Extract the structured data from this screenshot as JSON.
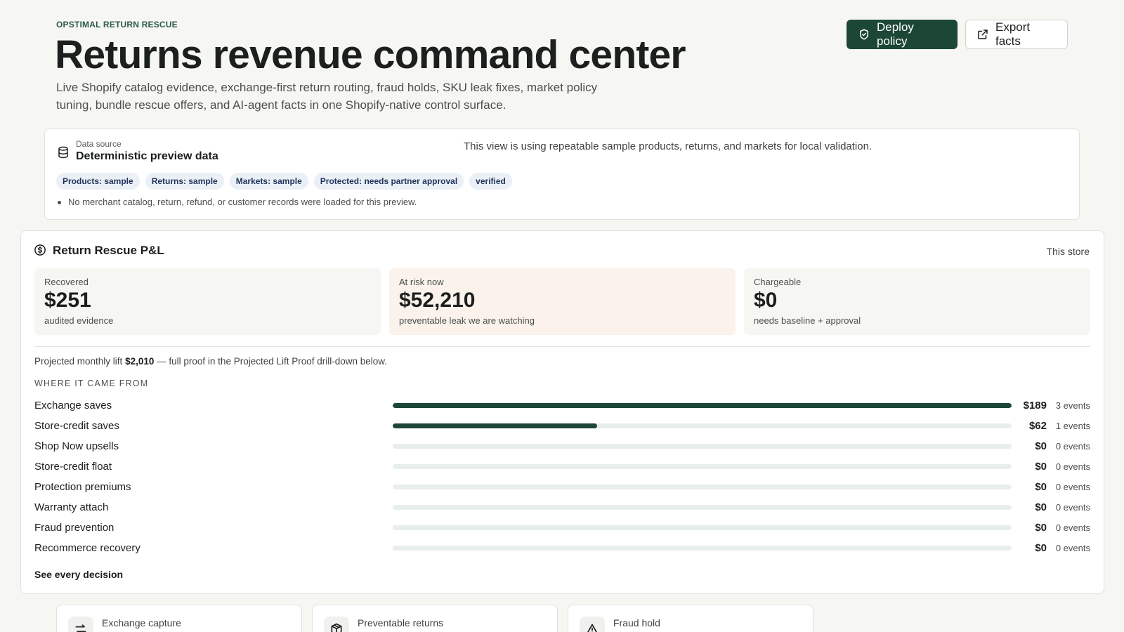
{
  "header": {
    "eyebrow": "OPSTIMAL RETURN RESCUE",
    "title": "Returns revenue command center",
    "subtitle": "Live Shopify catalog evidence, exchange-first return routing, fraud holds, SKU leak fixes, market policy tuning, bundle rescue offers, and AI-agent facts in one Shopify-native control surface.",
    "deploy_label": "Deploy policy",
    "export_label": "Export facts"
  },
  "data_source": {
    "label": "Data source",
    "title": "Deterministic preview data",
    "note": "This view is using repeatable sample products, returns, and markets for local validation.",
    "chips": [
      "Products: sample",
      "Returns: sample",
      "Markets: sample",
      "Protected: needs partner approval",
      "verified"
    ],
    "bullet": "No merchant catalog, return, refund, or customer records were loaded for this preview."
  },
  "pl": {
    "title": "Return Rescue P&L",
    "scope": "This store",
    "metrics": [
      {
        "label": "Recovered",
        "value": "$251",
        "sub": "audited evidence"
      },
      {
        "label": "At risk now",
        "value": "$52,210",
        "sub": "preventable leak we are watching"
      },
      {
        "label": "Chargeable",
        "value": "$0",
        "sub": "needs baseline + approval"
      }
    ],
    "lift_prefix": "Projected monthly lift",
    "lift_value": "$2,010",
    "lift_suffix": "— full proof in the Projected Lift Proof drill-down below.",
    "where_label": "WHERE IT CAME FROM",
    "rows": [
      {
        "label": "Exchange saves",
        "value": "$189",
        "events": "3 events",
        "share": 1.0
      },
      {
        "label": "Store-credit saves",
        "value": "$62",
        "events": "1 events",
        "share": 0.33
      },
      {
        "label": "Shop Now upsells",
        "value": "$0",
        "events": "0 events",
        "share": 0
      },
      {
        "label": "Store-credit float",
        "value": "$0",
        "events": "0 events",
        "share": 0
      },
      {
        "label": "Protection premiums",
        "value": "$0",
        "events": "0 events",
        "share": 0
      },
      {
        "label": "Warranty attach",
        "value": "$0",
        "events": "0 events",
        "share": 0
      },
      {
        "label": "Fraud prevention",
        "value": "$0",
        "events": "0 events",
        "share": 0
      },
      {
        "label": "Recommerce recovery",
        "value": "$0",
        "events": "0 events",
        "share": 0
      }
    ],
    "see_all": "See every decision"
  },
  "cards": [
    {
      "label": "Exchange capture",
      "icon": "exchange-arrows-icon"
    },
    {
      "label": "Preventable returns",
      "icon": "package-icon"
    },
    {
      "label": "Fraud hold",
      "icon": "warning-triangle-icon"
    }
  ],
  "colors": {
    "brand": "#1c4737",
    "background": "#f6f6f3",
    "risk_tint": "#fbf2ec",
    "chip_bg": "#eaf0f5"
  }
}
